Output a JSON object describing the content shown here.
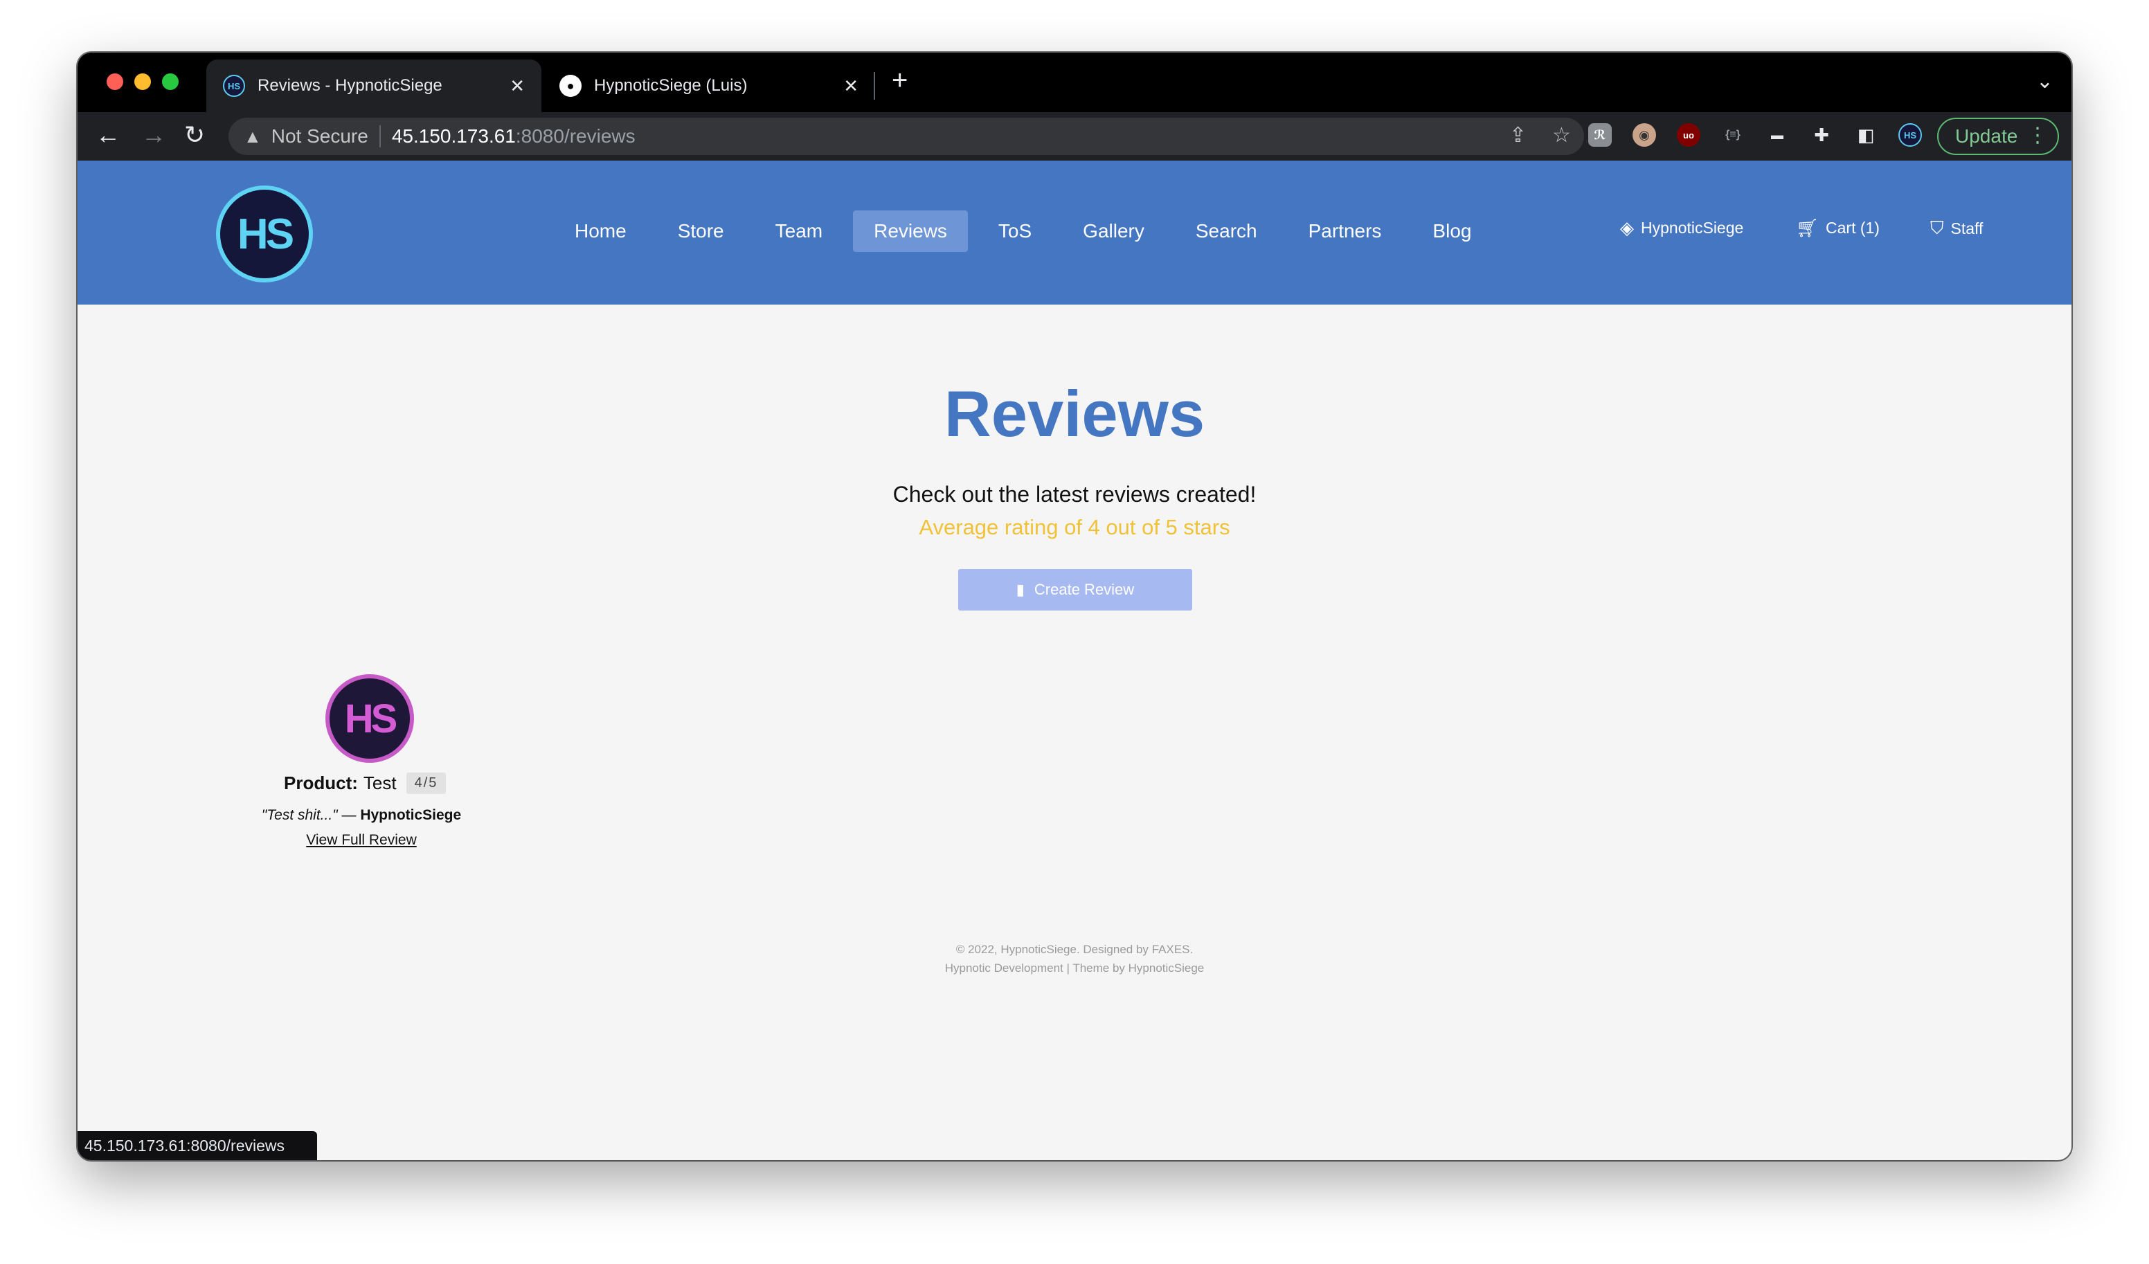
{
  "browser": {
    "tabs": [
      {
        "title": "Reviews - HypnoticSiege",
        "favicon": "hs-logo-icon",
        "active": true
      },
      {
        "title": "HypnoticSiege (Luis)",
        "favicon": "github-icon",
        "active": false
      }
    ],
    "address": {
      "security_label": "Not Secure",
      "host": "45.150.173.61",
      "path": ":8080/reviews"
    },
    "update_label": "Update",
    "status_url": "45.150.173.61:8080/reviews"
  },
  "site": {
    "logo_text": "HS",
    "nav": [
      {
        "label": "Home"
      },
      {
        "label": "Store"
      },
      {
        "label": "Team"
      },
      {
        "label": "Reviews",
        "active": true
      },
      {
        "label": "ToS"
      },
      {
        "label": "Gallery"
      },
      {
        "label": "Search"
      },
      {
        "label": "Partners"
      },
      {
        "label": "Blog"
      }
    ],
    "right_nav": {
      "discord_label": "HypnoticSiege",
      "cart_label": "Cart (1)",
      "staff_label": "Staff"
    },
    "accent": "#4576c2"
  },
  "main": {
    "title": "Reviews",
    "subtitle": "Check out the latest reviews created!",
    "average": "Average rating of 4 out of 5 stars",
    "create_button": "Create Review",
    "reviews": [
      {
        "avatar_text": "HS",
        "product_label": "Product:",
        "product": "Test",
        "rating": "4/5",
        "quote": "\"Test shit...\"",
        "separator": " — ",
        "author": "HypnoticSiege",
        "link": "View Full Review"
      }
    ]
  },
  "footer": {
    "line1": "© 2022, HypnoticSiege. Designed by FAXES.",
    "line2": "Hypnotic Development | Theme by HypnoticSiege"
  }
}
